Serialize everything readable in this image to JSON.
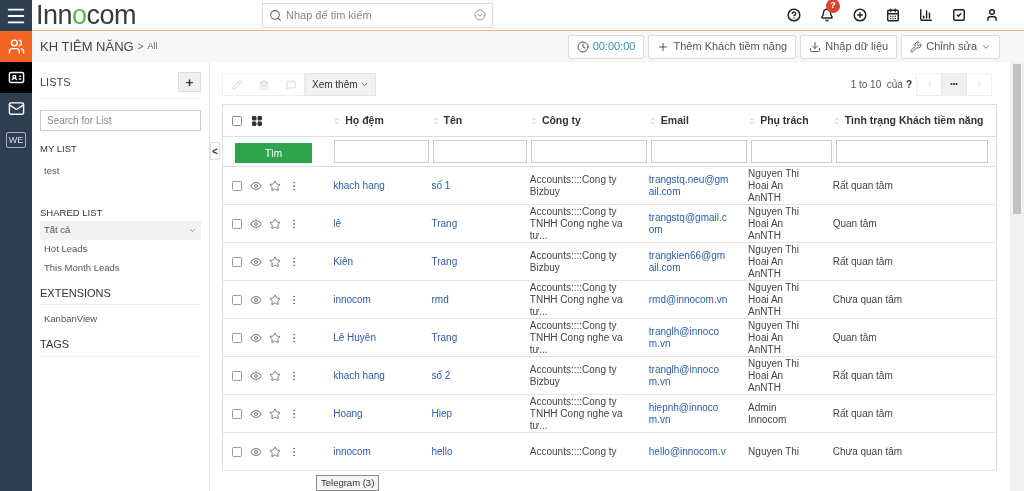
{
  "logo": {
    "parts": [
      "Inn",
      "o",
      "com"
    ]
  },
  "search": {
    "placeholder": "Nhap để tim kiếm"
  },
  "top_icons": [
    {
      "kind": "help"
    },
    {
      "kind": "bell",
      "badge": "?"
    },
    {
      "kind": "plus"
    },
    {
      "kind": "calendar"
    },
    {
      "kind": "chart"
    },
    {
      "kind": "tasks"
    },
    {
      "kind": "user"
    }
  ],
  "rail": [
    {
      "kind": "menu",
      "selected": false
    },
    {
      "kind": "users",
      "selected": false
    },
    {
      "kind": "card",
      "selected": true
    },
    {
      "kind": "mail",
      "selected": false
    },
    {
      "kind": "text",
      "label": "WE",
      "selected": false
    }
  ],
  "breadcrumb": {
    "module": "KH TIÊM NĂNG",
    "separator": ">",
    "view": "All"
  },
  "header_buttons": [
    {
      "kind": "timer",
      "label": "00:00:00"
    },
    {
      "kind": "add",
      "label": "Thêm Khách tiềm năng"
    },
    {
      "kind": "import",
      "label": "Nhập dữ liệu"
    },
    {
      "kind": "edit",
      "label": "Chỉnh sửa"
    }
  ],
  "sidebar": {
    "title": "LISTS",
    "add": "+",
    "search_placeholder": "Search for List",
    "sections": [
      {
        "title": "MY LIST",
        "items": [
          {
            "label": "test",
            "selected": false
          }
        ]
      },
      {
        "title": "SHARED LIST",
        "items": [
          {
            "label": "Tất cả",
            "selected": true
          },
          {
            "label": "Hot Leads",
            "selected": false
          },
          {
            "label": "This Month Leads",
            "selected": false
          }
        ]
      },
      {
        "title": "EXTENSIONS",
        "items": [
          {
            "label": "KanbanView",
            "selected": false
          }
        ]
      },
      {
        "title": "TAGS"
      }
    ]
  },
  "collapse": "<",
  "toolbar": {
    "more": "Xem thêm",
    "pagination": "1 to 10  của",
    "total": "?",
    "pager_more": "•••"
  },
  "table": {
    "find": "Tìm",
    "columns": [
      "Họ đệm",
      "Tên",
      "Công ty",
      "Email",
      "Phụ trách",
      "Tình trạng Khách tiềm năng"
    ],
    "rows": [
      {
        "checked": false,
        "starred": false,
        "cells": [
          "khach hang",
          "số 1",
          "Accounts::::Cong ty Bizbuy",
          "trangstq.neu@gmail.com",
          "Nguyen Thi Hoai An AnNTH",
          "Rất quan tâm"
        ]
      },
      {
        "checked": false,
        "starred": false,
        "cells": [
          "lê",
          "Trang",
          "Accounts::::Cong ty TNHH Cong nghe va tư...",
          "trangstq@gmail.com",
          "Nguyen Thi Hoai An AnNTH",
          "Quan tâm"
        ]
      },
      {
        "checked": false,
        "starred": false,
        "cells": [
          "Kiên",
          "Trang",
          "Accounts::::Cong ty Bizbuy",
          "trangkien66@gmail.com",
          "Nguyen Thi Hoai An AnNTH",
          "Rất quan tâm"
        ]
      },
      {
        "checked": false,
        "starred": false,
        "cells": [
          "innocom",
          "rmd",
          "Accounts::::Cong ty TNHH Cong nghe va tư...",
          "rmd@innocom.vn",
          "Nguyen Thi Hoai An AnNTH",
          "Chưa quan tâm"
        ]
      },
      {
        "checked": false,
        "starred": false,
        "cells": [
          "Lê Huyên",
          "Trang",
          "Accounts::::Cong ty TNHH Cong nghe va tư...",
          "tranglh@innocom.vn",
          "Nguyen Thi Hoai An AnNTH",
          "Quan tâm"
        ]
      },
      {
        "checked": false,
        "starred": false,
        "cells": [
          "khach hang",
          "số 2",
          "Accounts::::Cong ty Bizbuy",
          "tranglh@innocom.vn",
          "Nguyen Thi Hoai An AnNTH",
          "Rất quan tâm"
        ]
      },
      {
        "checked": false,
        "starred": false,
        "cells": [
          "Hoang",
          "Hiep",
          "Accounts::::Cong ty TNHH Cong nghe va tư...",
          "hiepnh@innocom.vn",
          "Admin Innocom",
          "Rất quan tâm"
        ]
      },
      {
        "checked": false,
        "starred": false,
        "cells": [
          "innocom",
          "hello",
          "Accounts::::Cong ty",
          "hello@innocom.v",
          "Nguyen Thi",
          "Chưa quan tâm"
        ]
      }
    ]
  },
  "tooltip": "Telegram (3)"
}
